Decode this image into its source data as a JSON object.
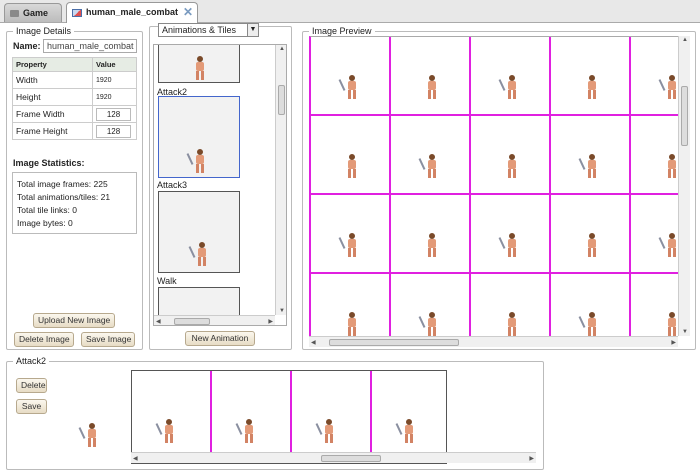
{
  "tabs": [
    {
      "label": "Game",
      "active": false
    },
    {
      "label": "human_male_combat",
      "active": true
    }
  ],
  "image_details": {
    "legend": "Image Details",
    "name_label": "Name:",
    "name_value": "human_male_combat",
    "columns": [
      "Property",
      "Value"
    ],
    "rows": [
      {
        "property": "Width",
        "value": "1920"
      },
      {
        "property": "Height",
        "value": "1920"
      },
      {
        "property": "Frame Width",
        "value": "128"
      },
      {
        "property": "Frame Height",
        "value": "128"
      }
    ],
    "stats_title": "Image Statistics:",
    "stats": [
      "Total image frames: 225",
      "Total animations/tiles: 21",
      "Total tile links: 0",
      "Image bytes: 0"
    ],
    "upload_button": "Upload New Image",
    "delete_button": "Delete Image",
    "save_button": "Save Image"
  },
  "animations": {
    "dropdown_value": "Animations & Tiles",
    "items": [
      {
        "label": "Attack2",
        "selected": true
      },
      {
        "label": "Attack3",
        "selected": false
      },
      {
        "label": "Walk",
        "selected": false
      }
    ],
    "new_button": "New Animation"
  },
  "preview": {
    "legend": "Image Preview"
  },
  "editor": {
    "legend": "Attack2",
    "delete_button": "Delete",
    "save_button": "Save"
  },
  "colors": {
    "grid_line": "#e020e0",
    "selected_frame": "#4466cc"
  }
}
